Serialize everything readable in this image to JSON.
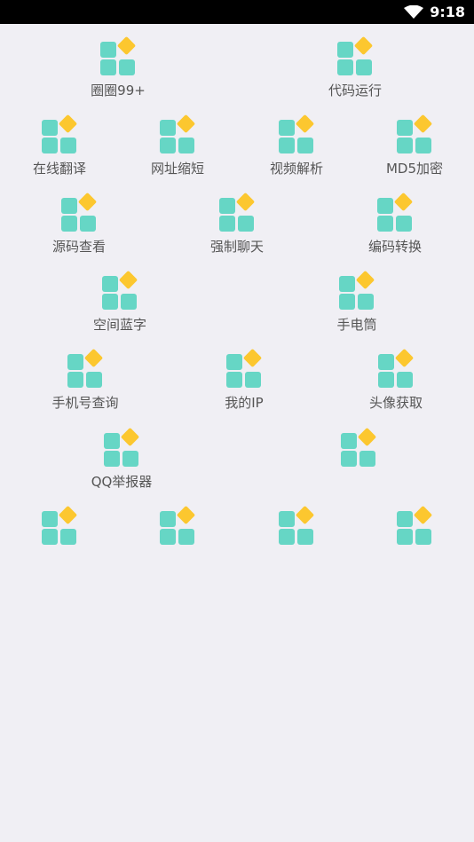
{
  "status_bar": {
    "time": "9:18"
  },
  "grid": {
    "r1": [
      "圈圈99+",
      "代码运行"
    ],
    "r2": [
      "在线翻译",
      "网址缩短",
      "视频解析",
      "MD5加密"
    ],
    "r3": [
      "源码查看",
      "强制聊天",
      "编码转换"
    ],
    "r4": [
      "空间蓝字",
      "手电筒"
    ],
    "r5": [
      "手机号查询",
      "我的IP",
      "头像获取"
    ],
    "r6": [
      "QQ举报器",
      ""
    ],
    "r7": [
      "",
      "",
      "",
      ""
    ]
  },
  "colors": {
    "tile": "#66d6c5",
    "diamond": "#fcc72f",
    "background": "#f0eff4"
  }
}
